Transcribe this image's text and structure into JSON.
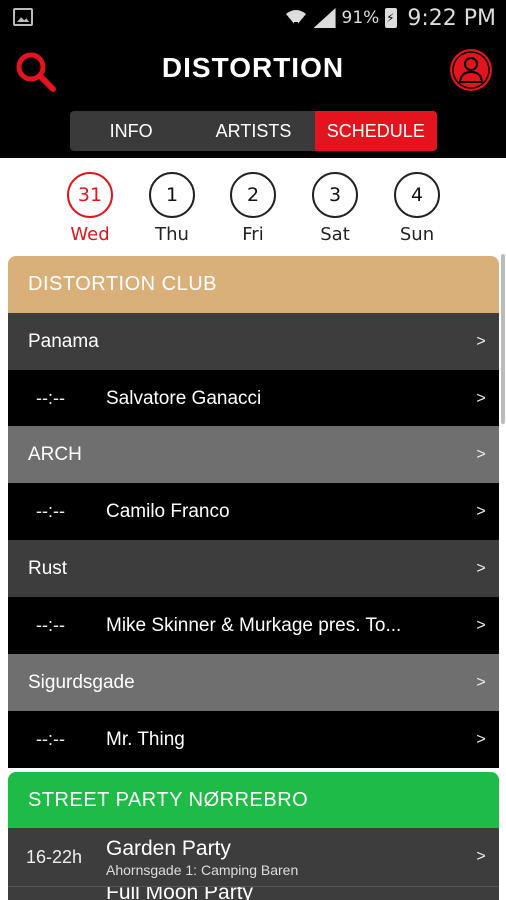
{
  "status": {
    "battery": "91%",
    "time": "9:22 PM",
    "icons": [
      "image-icon",
      "wifi-icon",
      "signal-icon",
      "battery-charging-icon"
    ]
  },
  "header": {
    "title": "DISTORTION",
    "search_icon": "search-icon",
    "profile_icon": "profile-icon"
  },
  "tabs": [
    {
      "label": "INFO",
      "active": false
    },
    {
      "label": "ARTISTS",
      "active": false
    },
    {
      "label": "SCHEDULE",
      "active": true
    }
  ],
  "days": [
    {
      "num": "31",
      "label": "Wed",
      "selected": true
    },
    {
      "num": "1",
      "label": "Thu",
      "selected": false
    },
    {
      "num": "2",
      "label": "Fri",
      "selected": false
    },
    {
      "num": "3",
      "label": "Sat",
      "selected": false
    },
    {
      "num": "4",
      "label": "Sun",
      "selected": false
    }
  ],
  "sections": [
    {
      "title": "DISTORTION CLUB",
      "color": "#d9b07a",
      "rows": [
        {
          "type": "venue",
          "label": "Panama",
          "color": "#3d3d3d"
        },
        {
          "type": "act",
          "time": "--:--",
          "label": "Salvatore Ganacci"
        },
        {
          "type": "venue",
          "label": "ARCH",
          "color": "#6f6f6f"
        },
        {
          "type": "act",
          "time": "--:--",
          "label": "Camilo Franco"
        },
        {
          "type": "venue",
          "label": "Rust",
          "color": "#3d3d3d"
        },
        {
          "type": "act",
          "time": "--:--",
          "label": "Mike Skinner & Murkage pres. To..."
        },
        {
          "type": "venue",
          "label": "Sigurdsgade",
          "color": "#6f6f6f"
        },
        {
          "type": "act",
          "time": "--:--",
          "label": "Mr. Thing"
        }
      ]
    },
    {
      "title": "STREET PARTY NØRREBRO",
      "color": "#1ebc47",
      "rows": [
        {
          "type": "event",
          "time": "16-22h",
          "label": "Garden Party",
          "sub": "Ahornsgade 1: Camping Baren"
        },
        {
          "type": "event",
          "time": "",
          "label": "Full Moon Party",
          "sub": ""
        }
      ]
    }
  ],
  "chevron": ">",
  "colors": {
    "accent": "#e3141d",
    "act_row": "#000000",
    "event_row": "#3d3d3d"
  }
}
